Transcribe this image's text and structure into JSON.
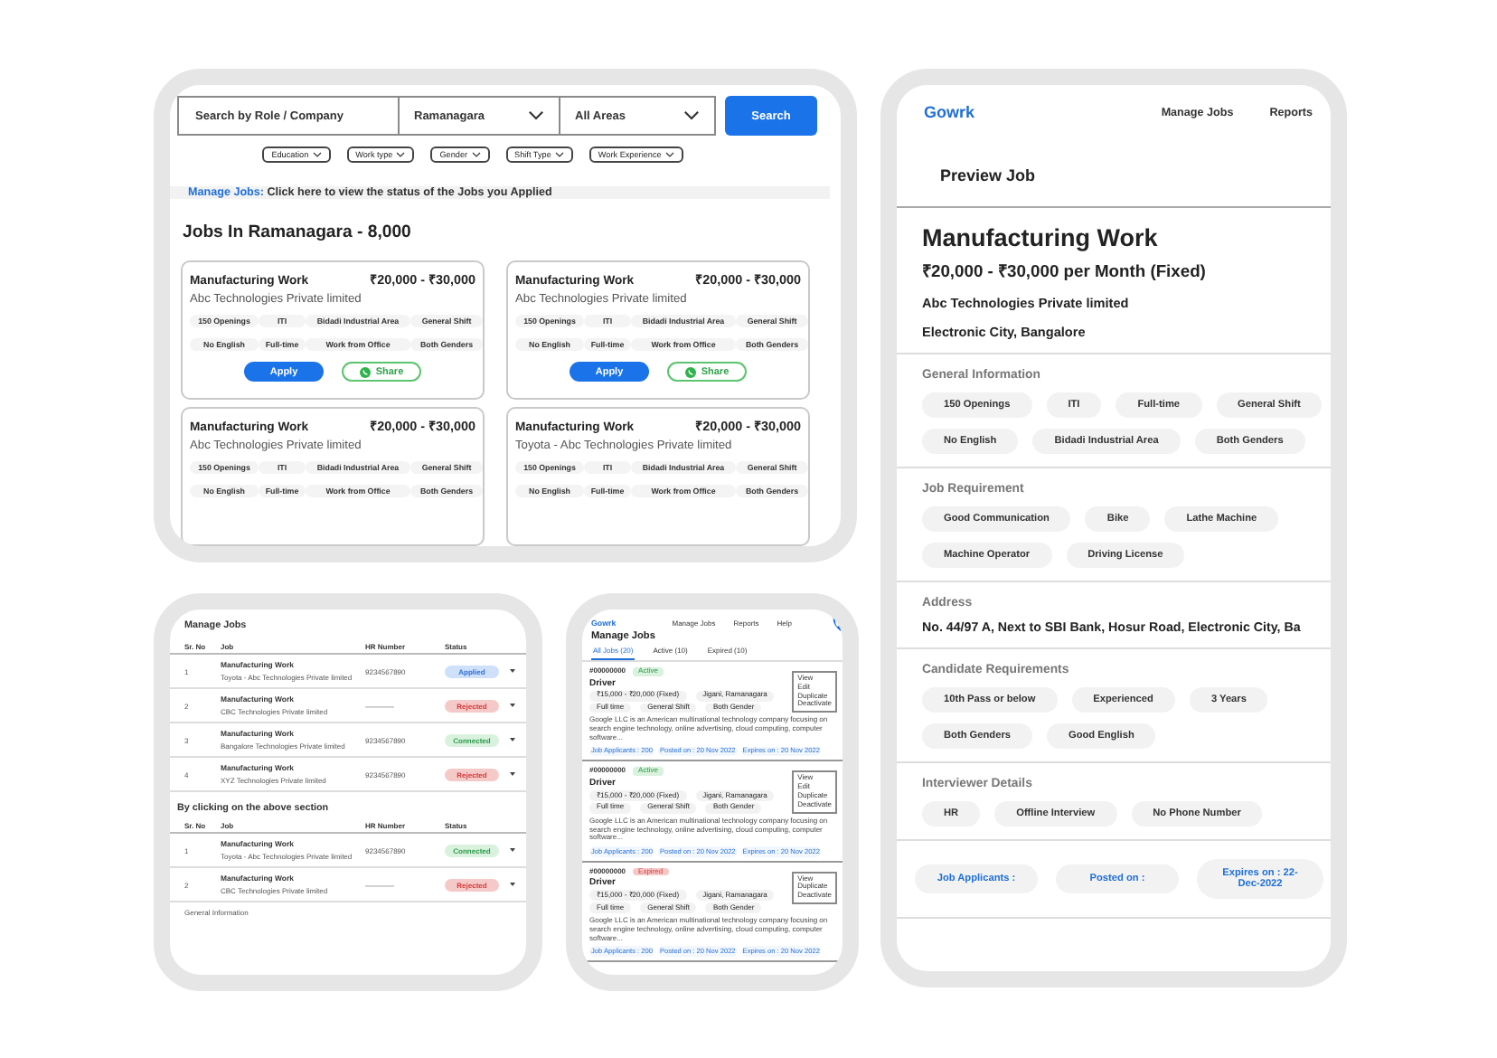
{
  "search_page": {
    "search_field": {
      "placeholder": "Search by Role / Company"
    },
    "city_select": {
      "value": "Ramanagara"
    },
    "area_select": {
      "value": "All Areas"
    },
    "search_button": "Search",
    "filters": [
      "Education",
      "Work type",
      "Gender",
      "Shift Type",
      "Work Experience"
    ],
    "banner": {
      "link": "Manage Jobs:",
      "text": "Click here to view the status of the Jobs you Applied"
    },
    "heading": "Jobs In Ramanagara - 8,000",
    "job_cards": [
      {
        "title": "Manufacturing Work",
        "salary": "₹20,000 - ₹30,000",
        "company": "Abc Technologies Private limited",
        "tags": [
          "150 Openings",
          "ITI",
          "Bidadi Industrial Area",
          "General Shift",
          "No English",
          "Full-time",
          "Work from Office",
          "Both Genders"
        ],
        "actions": {
          "apply": "Apply",
          "share": "Share"
        }
      },
      {
        "title": "Manufacturing Work",
        "salary": "₹20,000 - ₹30,000",
        "company": "Abc Technologies Private limited",
        "tags": [
          "150 Openings",
          "ITI",
          "Bidadi Industrial Area",
          "General Shift",
          "No English",
          "Full-time",
          "Work from Office",
          "Both Genders"
        ],
        "actions": {
          "apply": "Apply",
          "share": "Share"
        }
      },
      {
        "title": "Manufacturing Work",
        "salary": "₹20,000 - ₹30,000",
        "company": "Abc Technologies Private limited",
        "tags": [
          "150 Openings",
          "ITI",
          "Bidadi Industrial Area",
          "General Shift",
          "No English",
          "Full-time",
          "Work from Office",
          "Both Genders"
        ]
      },
      {
        "title": "Manufacturing Work",
        "salary": "₹20,000 - ₹30,000",
        "company": "Toyota - Abc Technologies Private limited",
        "tags": [
          "150 Openings",
          "ITI",
          "Bidadi Industrial Area",
          "General Shift",
          "No English",
          "Full-time",
          "Work from Office",
          "Both Genders"
        ]
      }
    ]
  },
  "preview": {
    "brand": "Gowrk",
    "nav": [
      "Manage Jobs",
      "Reports"
    ],
    "page_title": "Preview Job",
    "title": "Manufacturing Work",
    "salary": "₹20,000 - ₹30,000 per Month (Fixed)",
    "company": "Abc Technologies Private limited",
    "location": "Electronic City, Bangalore",
    "sections": [
      {
        "heading": "General Information",
        "kind": "chips",
        "chips": [
          "150 Openings",
          "ITI",
          "Full-time",
          "General Shift",
          "No English",
          "Bidadi Industrial Area",
          "Both Genders"
        ]
      },
      {
        "heading": "Job Requirement",
        "kind": "chips",
        "chips": [
          "Good Communication",
          "Bike",
          "Lathe Machine",
          "Machine Operator",
          "Driving License"
        ]
      },
      {
        "heading": "Address",
        "kind": "text",
        "text": "No. 44/97 A, Next to SBI Bank, Hosur Road, Electronic City, Ba"
      },
      {
        "heading": "Candidate Requirements",
        "kind": "chips",
        "chips": [
          "10th  Pass or below",
          "Experienced",
          "3 Years",
          "Both Genders",
          "Good English"
        ]
      },
      {
        "heading": "Interviewer Details",
        "kind": "chips",
        "chips": [
          "HR",
          "Offline Interview",
          "No Phone Number"
        ]
      }
    ],
    "footer": [
      "Job Applicants :",
      "Posted on :",
      "Expires on : 22-Dec-2022"
    ]
  },
  "manage_table": {
    "title": "Manage Jobs",
    "columns": [
      "Sr. No",
      "Job",
      "HR Number",
      "Status"
    ],
    "rows": [
      {
        "sr": "1",
        "job": "Manufacturing Work",
        "company": "Toyota - Abc Technologies Private limited",
        "hr": "9234567890",
        "status": "Applied",
        "color": "#cfe0fb"
      },
      {
        "sr": "2",
        "job": "Manufacturing Work",
        "company": "CBC Technologies Private limited",
        "hr": "————",
        "status": "Rejected",
        "color": "#f6c9c9"
      },
      {
        "sr": "3",
        "job": "Manufacturing Work",
        "company": "Bangalore Technologies Private limited",
        "hr": "9234567890",
        "status": "Connected",
        "color": "#d8f2de"
      },
      {
        "sr": "4",
        "job": "Manufacturing Work",
        "company": "XYZ Technologies Private limited",
        "hr": "9234567890",
        "status": "Rejected",
        "color": "#f6c9c9"
      }
    ],
    "subheading": "By clicking on the above section",
    "columns_2": [
      "Sr. No",
      "Job",
      "HR Number",
      "Status"
    ],
    "rows_2": [
      {
        "sr": "1",
        "job": "Manufacturing Work",
        "company": "Toyota - Abc Technologies Private limited",
        "hr": "9234567890",
        "status": "Connected",
        "color": "#d8f2de"
      },
      {
        "sr": "2",
        "job": "Manufacturing Work",
        "company": "CBC Technologies Private limited",
        "hr": "————",
        "status": "Rejected",
        "color": "#f6c9c9"
      }
    ],
    "footnote": "General Information"
  },
  "manage_list": {
    "brand": "Gowrk",
    "nav": [
      "Manage Jobs",
      "Reports",
      "Help"
    ],
    "title": "Manage Jobs",
    "tabs": [
      {
        "label": "All Jobs (20)",
        "selected": true
      },
      {
        "label": "Active (10)",
        "selected": false
      },
      {
        "label": "Expired (10)",
        "selected": false
      }
    ],
    "cards": [
      {
        "id": "#00000000",
        "status": "Active",
        "color": "#d8f2de",
        "title": "Driver",
        "chips": [
          "₹15,000 - ₹20,000 (Fixed)",
          "Jigani, Ramanagara",
          "Full time",
          "General Shift",
          "Both Gender"
        ],
        "description": "Google LLC is an American multinational technology company focusing on search engine technology, online advertising, cloud computing, computer software...",
        "footer": [
          "Job Applicants : 200",
          "Posted on : 20 Nov 2022",
          "Expires on : 20 Nov 2022"
        ],
        "menu": [
          "View",
          "Edit",
          "Duplicate",
          "Deactivate"
        ]
      },
      {
        "id": "#00000000",
        "status": "Active",
        "color": "#d8f2de",
        "title": "Driver",
        "chips": [
          "₹15,000 - ₹20,000 (Fixed)",
          "Jigani, Ramanagara",
          "Full time",
          "General Shift",
          "Both Gender"
        ],
        "description": "Google LLC is an American multinational technology company focusing on search engine technology, online advertising, cloud computing, computer software...",
        "footer": [
          "Job Applicants : 200",
          "Posted on : 20 Nov 2022",
          "Expires on : 20 Nov 2022"
        ],
        "menu": [
          "View",
          "Edit",
          "Duplicate",
          "Deactivate"
        ]
      },
      {
        "id": "#00000000",
        "status": "Expired",
        "color": "#f6c9c9",
        "title": "Driver",
        "chips": [
          "₹15,000 - ₹20,000 (Fixed)",
          "Jigani, Ramanagara",
          "Full time",
          "General Shift",
          "Both Gender"
        ],
        "description": "Google LLC is an American multinational technology company focusing on search engine technology, online advertising, cloud computing, computer software...",
        "footer": [
          "Job Applicants : 200",
          "Posted on : 20 Nov 2022",
          "Expires on : 20 Nov 2022"
        ],
        "menu": [
          "View",
          "Duplicate",
          "Deactivate"
        ]
      }
    ]
  }
}
